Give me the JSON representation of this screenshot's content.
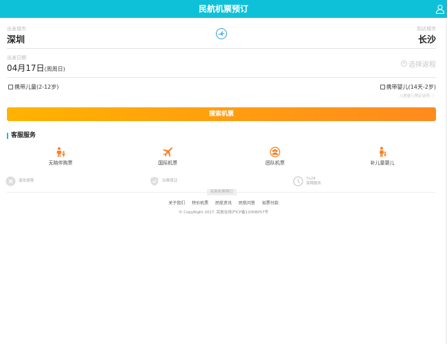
{
  "header": {
    "title": "民航机票预订",
    "user_icon": "user-icon"
  },
  "departure": {
    "label": "出发城市",
    "city": "深圳"
  },
  "arrival": {
    "label": "到达城市",
    "city": "长沙"
  },
  "swap_icon": "airplane-swap-icon",
  "date": {
    "label": "出发日期",
    "value": "04月17日",
    "weekday": "(周周日)"
  },
  "return_trip": {
    "label": "选择返程"
  },
  "options": {
    "child": "携带儿童(2-12岁)",
    "infant": "携带婴儿(14天-2岁)",
    "note": "儿童婴儿预定说明"
  },
  "search_button": "搜索机票",
  "services": {
    "title": "客服服务",
    "items": [
      {
        "label": "无陪伴购票",
        "icon": "unaccompanied-icon"
      },
      {
        "label": "国际机票",
        "icon": "plane-icon"
      },
      {
        "label": "团队机票",
        "icon": "group-icon"
      },
      {
        "label": "补儿童婴儿",
        "icon": "family-icon"
      }
    ]
  },
  "guarantees": [
    {
      "line1": "退改保障",
      "line2": "",
      "icon": "close-circle-icon"
    },
    {
      "line1": "出票保证",
      "line2": "",
      "icon": "shield-icon"
    },
    {
      "line1": "7x24",
      "line2": "保障服务",
      "icon": "clock-icon"
    }
  ],
  "footer": {
    "badge": "民航机票预订",
    "links": [
      "关于我们",
      "特价机票",
      "民航资讯",
      "民航问答",
      "如票付款"
    ],
    "copyright": "© CopyRight 2017. 民航在线沪ICP备12008057号"
  },
  "colors": {
    "header": "#0fc1d8",
    "accent": "#ff8a1e",
    "service_icon": "#f5822a"
  }
}
